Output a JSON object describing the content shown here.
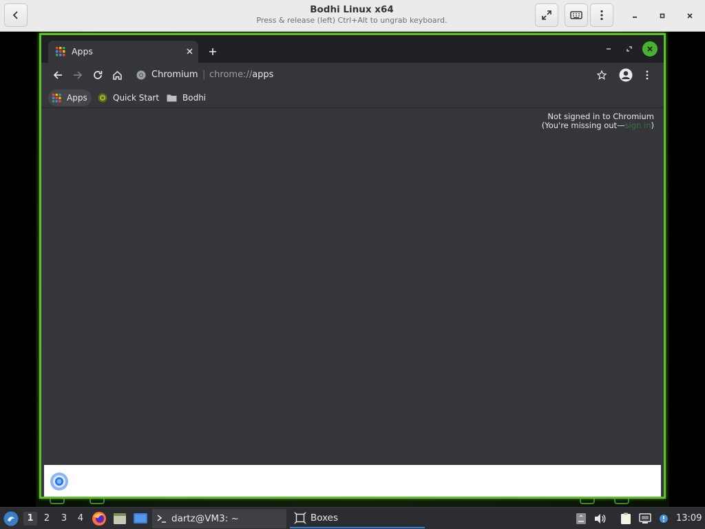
{
  "boxes": {
    "title": "Bodhi Linux x64",
    "subtitle": "Press & release (left) Ctrl+Alt to ungrab keyboard.",
    "icons": [
      "back-icon",
      "fullscreen-icon",
      "keyboard-icon",
      "kebab-menu-icon",
      "minimize-icon",
      "maximize-icon",
      "close-icon"
    ]
  },
  "browser": {
    "tab": {
      "title": "Apps"
    },
    "site_name": "Chromium",
    "separator": "|",
    "url_scheme": "chrome://",
    "url_host": "apps",
    "bookmarks": [
      {
        "label": "Apps",
        "icon": "apps-grid-icon"
      },
      {
        "label": "Quick Start",
        "icon": "bodhi-logo-icon"
      },
      {
        "label": "Bodhi",
        "icon": "folder-icon"
      }
    ],
    "signin": {
      "line1": "Not signed in to Chromium",
      "line2_prefix": "(You're missing out—",
      "link": "sign in",
      "line2_suffix": ")"
    },
    "accent": "#5fbf2c"
  },
  "taskbar": {
    "workspaces": [
      "1",
      "2",
      "3",
      "4"
    ],
    "active_workspace": "1",
    "tasks": [
      {
        "label": "dartz@VM3: ~",
        "icon": "terminal-icon"
      },
      {
        "label": "Boxes",
        "icon": "boxes-icon"
      }
    ],
    "clock": "13:09"
  }
}
